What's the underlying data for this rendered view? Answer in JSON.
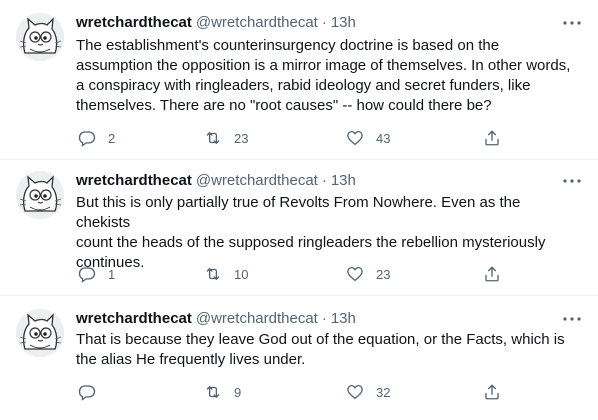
{
  "tweets": [
    {
      "display_name": "wretchardthecat",
      "handle": "@wretchardthecat",
      "separator": "·",
      "time": "13h",
      "lines": [
        "The establishment's counterinsurgency doctrine is based on the",
        "assumption the opposition is a mirror image of themselves. In other words,",
        "a conspiracy with ringleaders, rabid ideology and secret funders, like",
        "themselves. There are no \"root causes\" -- how could there be?"
      ],
      "replies": "2",
      "retweets": "23",
      "likes": "43"
    },
    {
      "display_name": "wretchardthecat",
      "handle": "@wretchardthecat",
      "separator": "·",
      "time": "13h",
      "lines": [
        "But this is only partially true of Revolts From Nowhere. Even as the chekists",
        "count the heads of the supposed ringleaders the rebellion mysteriously",
        "continues."
      ],
      "replies": "1",
      "retweets": "10",
      "likes": "23"
    },
    {
      "display_name": "wretchardthecat",
      "handle": "@wretchardthecat",
      "separator": "·",
      "time": "13h",
      "lines": [
        "That is because they leave God out of the equation, or the Facts, which is",
        "the alias He frequently lives under."
      ],
      "replies": "",
      "retweets": "9",
      "likes": "32"
    }
  ],
  "icons": {
    "reply": "reply-icon",
    "retweet": "retweet-icon",
    "like": "heart-icon",
    "share": "share-icon",
    "more": "more-options-icon",
    "avatar": "cat-cartoon-avatar"
  },
  "colors": {
    "text": "#0f1419",
    "secondary": "#536471",
    "divider": "#eff3f4"
  }
}
